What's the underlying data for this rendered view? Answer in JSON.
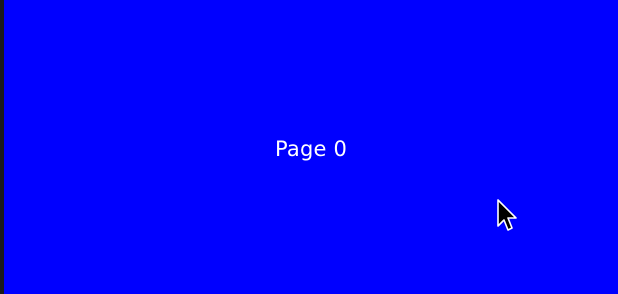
{
  "page": {
    "label": "Page 0",
    "background_color": "#0000ff",
    "text_color": "#ffffff"
  },
  "cursor": {
    "icon": "arrow-cursor-icon"
  }
}
